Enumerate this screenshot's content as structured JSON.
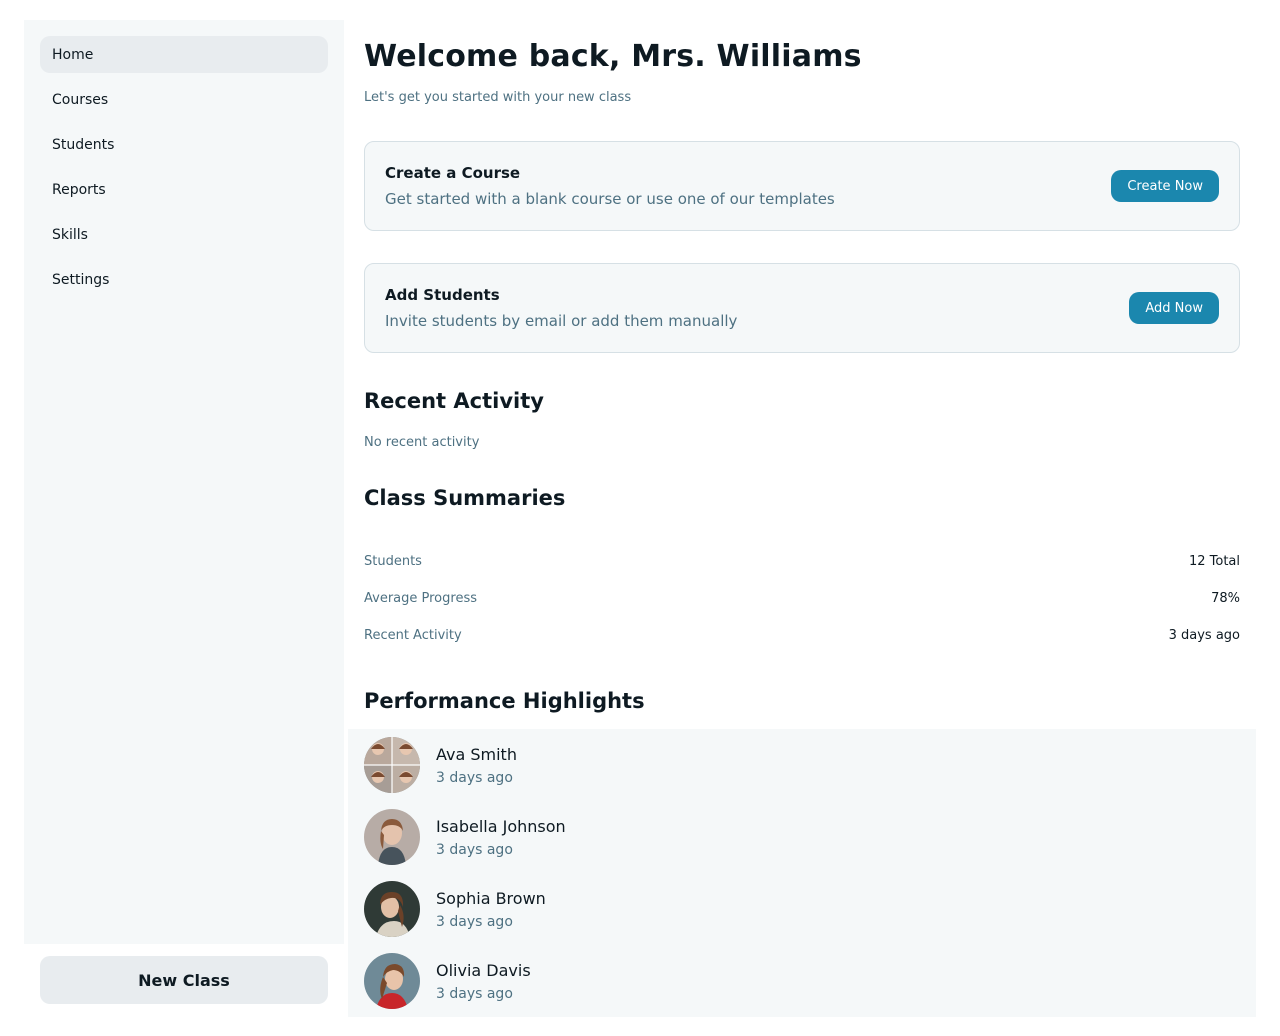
{
  "sidebar": {
    "items": [
      {
        "label": "Home",
        "active": true
      },
      {
        "label": "Courses"
      },
      {
        "label": "Students"
      },
      {
        "label": "Reports"
      },
      {
        "label": "Skills"
      },
      {
        "label": "Settings"
      }
    ],
    "new_class_label": "New Class"
  },
  "header": {
    "title": "Welcome back, Mrs. Williams",
    "subtitle": "Let's get you started with your new class"
  },
  "cards": [
    {
      "title": "Create a Course",
      "description": "Get started with a blank course or use one of our templates",
      "button": "Create Now"
    },
    {
      "title": "Add Students",
      "description": "Invite students by email or add them manually",
      "button": "Add Now"
    }
  ],
  "recent_activity": {
    "title": "Recent Activity",
    "empty_text": "No recent activity"
  },
  "class_summaries": {
    "title": "Class Summaries",
    "rows": [
      {
        "label": "Students",
        "value": "12 Total"
      },
      {
        "label": "Average Progress",
        "value": "78%"
      },
      {
        "label": "Recent Activity",
        "value": "3 days ago"
      }
    ]
  },
  "performance": {
    "title": "Performance Highlights",
    "students": [
      {
        "name": "Ava Smith",
        "time": "3 days ago"
      },
      {
        "name": "Isabella Johnson",
        "time": "3 days ago"
      },
      {
        "name": "Sophia Brown",
        "time": "3 days ago"
      },
      {
        "name": "Olivia Davis",
        "time": "3 days ago"
      }
    ]
  },
  "colors": {
    "accent": "#1b87ae",
    "muted_text": "#4e7182",
    "surface": "#f5f8f9"
  }
}
